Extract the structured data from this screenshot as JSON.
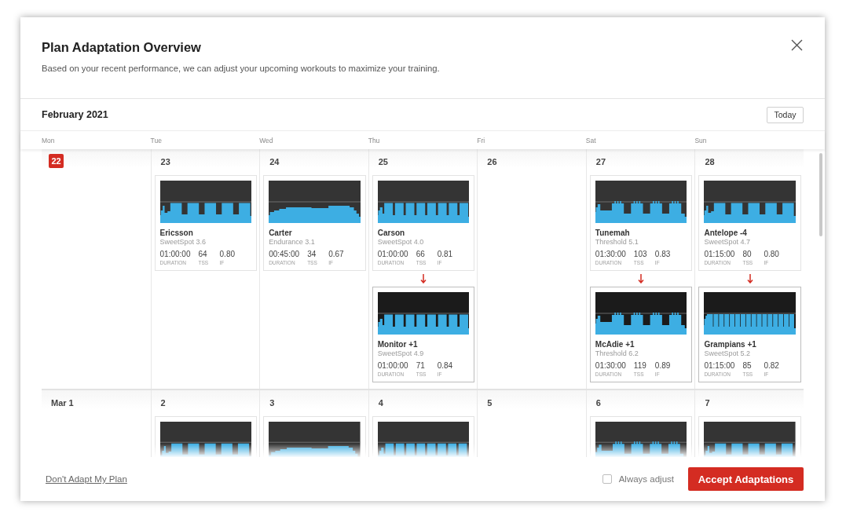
{
  "dialog": {
    "title": "Plan Adaptation Overview",
    "subtitle": "Based on your recent performance, we can adjust your upcoming workouts to maximize your training."
  },
  "calendar": {
    "month": "February 2021",
    "today_button": "Today",
    "weekdays": [
      "Mon",
      "Tue",
      "Wed",
      "Thu",
      "Fri",
      "Sat",
      "Sun"
    ],
    "weeks": [
      {
        "days": [
          {
            "date": "22",
            "today": true
          },
          {
            "date": "23",
            "today": false,
            "workout": {
              "kind": "blocks",
              "name": "Ericsson",
              "category": "SweetSpot 3.6",
              "stats": [
                {
                  "value": "01:00:00",
                  "label": "DURATION"
                },
                {
                  "value": "64",
                  "label": "TSS"
                },
                {
                  "value": "0.80",
                  "label": "IF"
                }
              ]
            }
          },
          {
            "date": "24",
            "today": false,
            "workout": {
              "kind": "steady",
              "name": "Carter",
              "category": "Endurance 3.1",
              "stats": [
                {
                  "value": "00:45:00",
                  "label": "DURATION"
                },
                {
                  "value": "34",
                  "label": "TSS"
                },
                {
                  "value": "0.67",
                  "label": "IF"
                }
              ]
            }
          },
          {
            "date": "25",
            "today": false,
            "workout": {
              "kind": "repeats",
              "name": "Carson",
              "category": "SweetSpot 4.0",
              "stats": [
                {
                  "value": "01:00:00",
                  "label": "DURATION"
                },
                {
                  "value": "66",
                  "label": "TSS"
                },
                {
                  "value": "0.81",
                  "label": "IF"
                }
              ]
            },
            "adaptation": {
              "kind": "repeats",
              "name": "Monitor +1",
              "category": "SweetSpot 4.9",
              "stats": [
                {
                  "value": "01:00:00",
                  "label": "DURATION"
                },
                {
                  "value": "71",
                  "label": "TSS"
                },
                {
                  "value": "0.84",
                  "label": "IF"
                }
              ]
            }
          },
          {
            "date": "26",
            "today": false
          },
          {
            "date": "27",
            "today": false,
            "workout": {
              "kind": "surges",
              "name": "Tunemah",
              "category": "Threshold 5.1",
              "stats": [
                {
                  "value": "01:30:00",
                  "label": "DURATION"
                },
                {
                  "value": "103",
                  "label": "TSS"
                },
                {
                  "value": "0.83",
                  "label": "IF"
                }
              ]
            },
            "adaptation": {
              "kind": "surges",
              "name": "McAdie +1",
              "category": "Threshold 6.2",
              "stats": [
                {
                  "value": "01:30:00",
                  "label": "DURATION"
                },
                {
                  "value": "119",
                  "label": "TSS"
                },
                {
                  "value": "0.89",
                  "label": "IF"
                }
              ]
            }
          },
          {
            "date": "28",
            "today": false,
            "workout": {
              "kind": "blocks",
              "name": "Antelope -4",
              "category": "SweetSpot 4.7",
              "stats": [
                {
                  "value": "01:15:00",
                  "label": "DURATION"
                },
                {
                  "value": "80",
                  "label": "TSS"
                },
                {
                  "value": "0.80",
                  "label": "IF"
                }
              ]
            },
            "adaptation": {
              "kind": "stripes",
              "name": "Grampians +1",
              "category": "SweetSpot 5.2",
              "stats": [
                {
                  "value": "01:15:00",
                  "label": "DURATION"
                },
                {
                  "value": "85",
                  "label": "TSS"
                },
                {
                  "value": "0.82",
                  "label": "IF"
                }
              ]
            }
          }
        ]
      },
      {
        "days": [
          {
            "date": "Mar 1",
            "today": false
          },
          {
            "date": "2",
            "today": false,
            "workout": {
              "kind": "blocks"
            }
          },
          {
            "date": "3",
            "today": false,
            "workout": {
              "kind": "steady"
            }
          },
          {
            "date": "4",
            "today": false,
            "workout": {
              "kind": "repeats"
            }
          },
          {
            "date": "5",
            "today": false
          },
          {
            "date": "6",
            "today": false,
            "workout": {
              "kind": "surges"
            }
          },
          {
            "date": "7",
            "today": false,
            "workout": {
              "kind": "blocks"
            }
          }
        ]
      }
    ]
  },
  "footer": {
    "decline_link": "Don't Adapt My Plan",
    "always_adjust": {
      "label": "Always adjust",
      "checked": false
    },
    "accept_button": "Accept Adaptations"
  }
}
